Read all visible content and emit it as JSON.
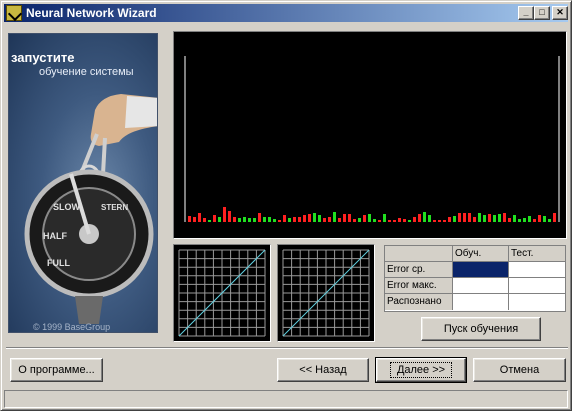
{
  "window": {
    "title": "Neural Network Wizard"
  },
  "title_buttons": {
    "minimize": "_",
    "maximize": "□",
    "close": "✕"
  },
  "banner": {
    "title": "запустите",
    "subtitle": "обучение системы",
    "copyright": "© 1999 BaseGroup"
  },
  "error_chart": {
    "train_color": "#ff2020",
    "test_color": "#20e020",
    "axis_color": "#ffffff"
  },
  "scatter_plots": {
    "grid_color": "#9a9a9a",
    "diagonal_color": "#60d0e0"
  },
  "stats_table": {
    "columns": [
      "",
      "Обуч.",
      "Тест."
    ],
    "rows": [
      {
        "label": "Error ср.",
        "train": "",
        "test": "",
        "selected": true
      },
      {
        "label": "Error макс.",
        "train": "",
        "test": "",
        "selected": false
      },
      {
        "label": "Распознано",
        "train": "",
        "test": "",
        "selected": false
      }
    ],
    "selection_color": "#0a246a"
  },
  "buttons": {
    "start_training": "Пуск обучения",
    "about": "О программе...",
    "back": "<< Назад",
    "next": "Далее >>",
    "cancel": "Отмена"
  }
}
